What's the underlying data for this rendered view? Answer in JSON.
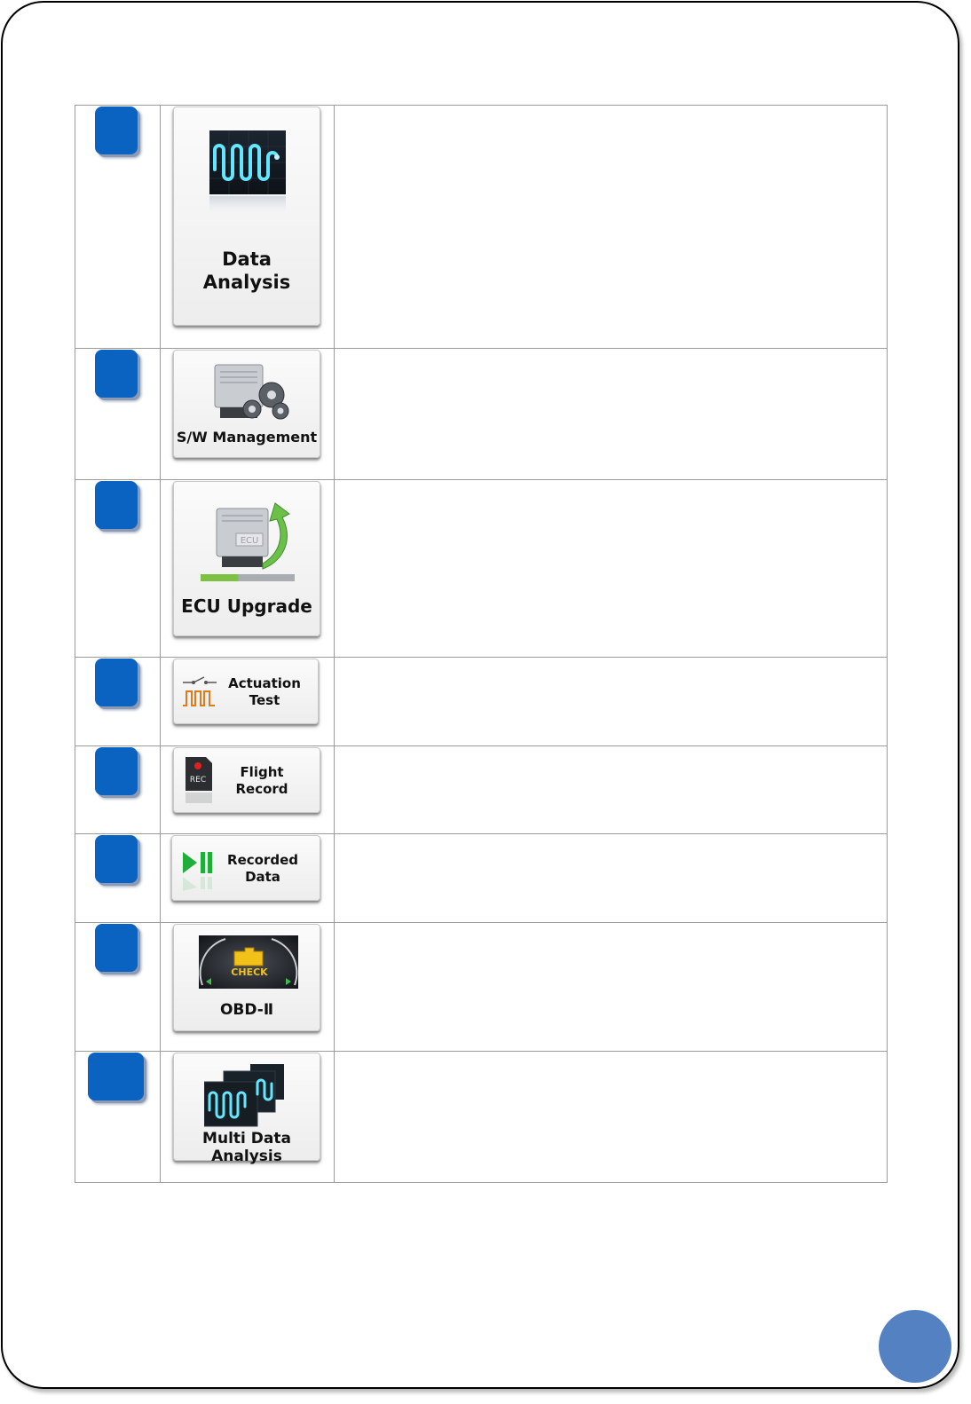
{
  "rows": [
    {
      "label_lines": [
        "Data",
        "Analysis"
      ],
      "icon": "waveform-monitor-icon"
    },
    {
      "label_lines": [
        "S/W Management"
      ],
      "icon": "ecu-gears-icon"
    },
    {
      "label_lines": [
        "ECU Upgrade"
      ],
      "icon": "ecu-upgrade-arrow-icon",
      "ecu_text": "ECU",
      "progress": 0.4
    },
    {
      "label_lines": [
        "Actuation",
        "Test"
      ],
      "icon": "switch-pulse-icon"
    },
    {
      "label_lines": [
        "Flight",
        "Record"
      ],
      "icon": "rec-card-icon",
      "rec_text": "REC"
    },
    {
      "label_lines": [
        "Recorded",
        "Data"
      ],
      "icon": "play-pause-icon"
    },
    {
      "label_lines": [
        "OBD-Ⅱ"
      ],
      "icon": "check-engine-dashboard-icon",
      "check_text": "CHECK"
    },
    {
      "label_lines": [
        "Multi Data Analysis"
      ],
      "icon": "multi-waveform-monitor-icon"
    }
  ],
  "colors": {
    "badge": "#0b63c1",
    "page_badge": "#5481c2",
    "progress_fill": "#7cc142"
  }
}
